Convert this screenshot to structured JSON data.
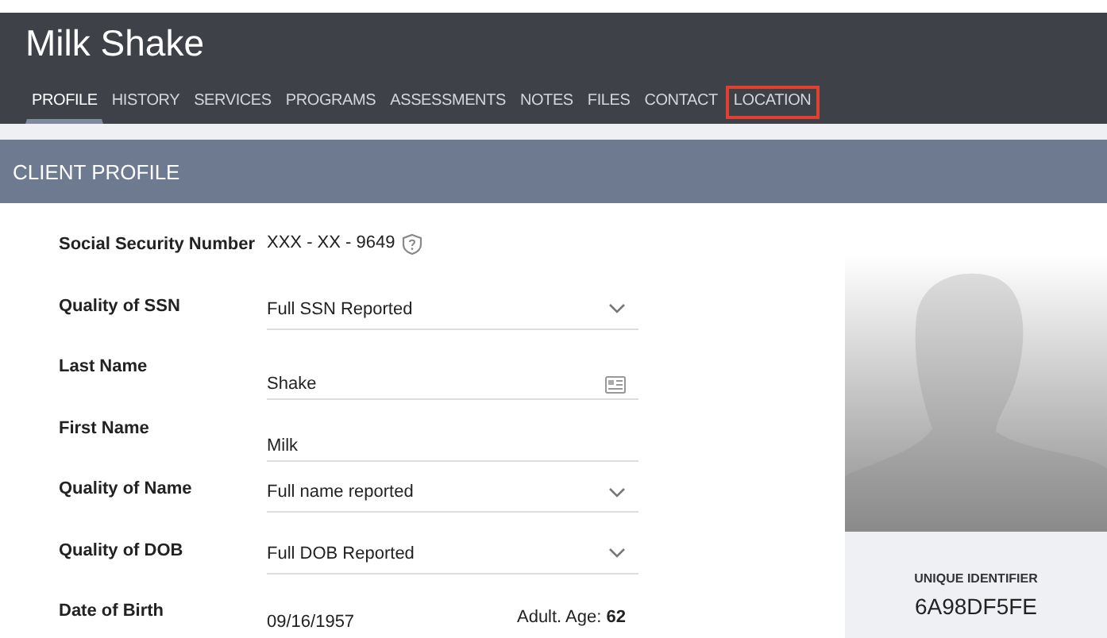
{
  "header": {
    "title": "Milk Shake"
  },
  "tabs": [
    {
      "label": "PROFILE",
      "selected": true,
      "highlighted": false
    },
    {
      "label": "HISTORY",
      "selected": false,
      "highlighted": false
    },
    {
      "label": "SERVICES",
      "selected": false,
      "highlighted": false
    },
    {
      "label": "PROGRAMS",
      "selected": false,
      "highlighted": false
    },
    {
      "label": "ASSESSMENTS",
      "selected": false,
      "highlighted": false
    },
    {
      "label": "NOTES",
      "selected": false,
      "highlighted": false
    },
    {
      "label": "FILES",
      "selected": false,
      "highlighted": false
    },
    {
      "label": "CONTACT",
      "selected": false,
      "highlighted": false
    },
    {
      "label": "LOCATION",
      "selected": false,
      "highlighted": true
    }
  ],
  "section": {
    "title": "CLIENT PROFILE"
  },
  "fields": [
    {
      "kind": "masked",
      "label": "Social Security Number",
      "value": "XXX - XX - 9649"
    },
    {
      "kind": "select",
      "label": "Quality of SSN",
      "value": "Full SSN Reported"
    },
    {
      "kind": "card-input",
      "label": "Last Name",
      "value": "Shake"
    },
    {
      "kind": "input",
      "label": "First Name",
      "value": "Milk"
    },
    {
      "kind": "select",
      "label": "Quality of Name",
      "value": "Full name reported"
    },
    {
      "kind": "select",
      "label": "Quality of DOB",
      "value": "Full DOB Reported"
    },
    {
      "kind": "date",
      "label": "Date of Birth",
      "value": "09/16/1957",
      "note": "Adult. Age: **62**"
    }
  ],
  "identity": {
    "label": "UNIQUE IDENTIFIER",
    "value": "6A98DF5FE"
  }
}
